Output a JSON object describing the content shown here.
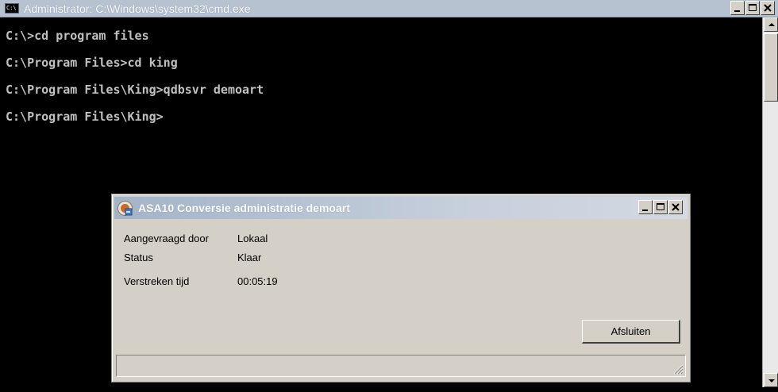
{
  "console_window": {
    "title": "Administrator: C:\\Windows\\system32\\cmd.exe",
    "icon_label": "C:\\",
    "lines": [
      "C:\\>cd program files",
      "C:\\Program Files>cd king",
      "C:\\Program Files\\King>qdbsvr demoart",
      "C:\\Program Files\\King>"
    ]
  },
  "dialog": {
    "title": "ASA10 Conversie administratie demoart",
    "fields": [
      {
        "label": "Aangevraagd door",
        "value": "Lokaal"
      },
      {
        "label": "Status",
        "value": "Klaar"
      },
      {
        "label": "Verstreken tijd",
        "value": "00:05:19"
      }
    ],
    "close_button_label": "Afsluiten"
  }
}
